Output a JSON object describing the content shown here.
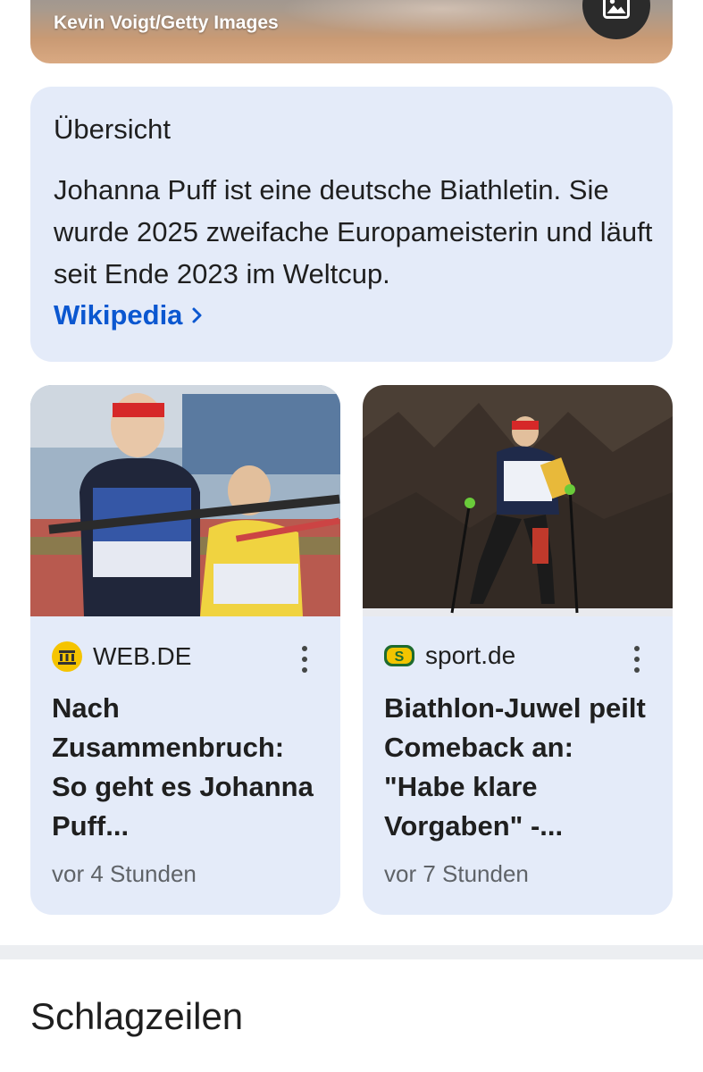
{
  "hero": {
    "credit": "Kevin Voigt/Getty Images",
    "button_icon": "image-icon"
  },
  "overview": {
    "title": "Übersicht",
    "text": "Johanna Puff ist eine deutsche Biathletin. Sie wurde 2025 zweifache Europameisterin und läuft seit Ende 2023 im Weltcup.",
    "link_label": "Wikipedia",
    "link_icon": "chevron-right-icon"
  },
  "news": [
    {
      "source": "WEB.DE",
      "headline": "Nach Zusammenbruch: So geht es Johanna Puff...",
      "time": "vor 4 Stunden",
      "logo_color": "#f5c400"
    },
    {
      "source": "sport.de",
      "headline": "Biathlon-Juwel peilt Comeback an: \"Habe klare Vorgaben\" -...",
      "time": "vor 7 Stunden",
      "logo_color": "#1e6b2e"
    }
  ],
  "section": {
    "title": "Schlagzeilen"
  }
}
